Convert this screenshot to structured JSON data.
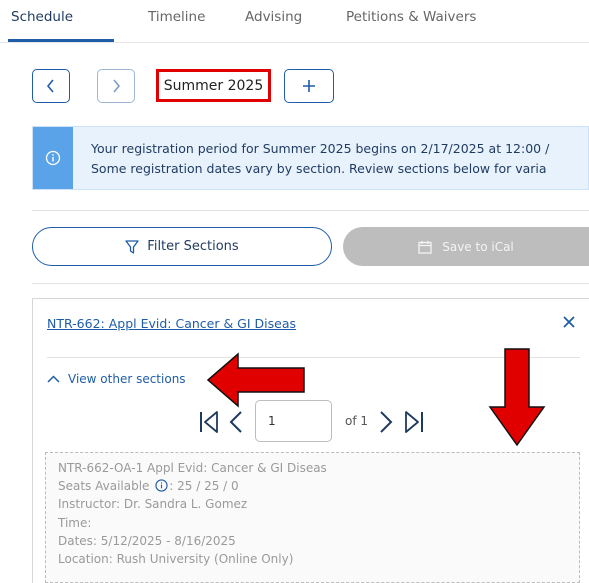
{
  "tabs": [
    {
      "label": "Schedule",
      "active": true
    },
    {
      "label": "Timeline",
      "active": false
    },
    {
      "label": "Advising",
      "active": false
    },
    {
      "label": "Petitions & Waivers",
      "active": false
    }
  ],
  "term": {
    "label": "Summer 2025"
  },
  "banner": {
    "line1": "Your registration period for Summer 2025 begins on 2/17/2025 at 12:00 /",
    "line2": "Some registration dates vary by section. Review sections below for varia"
  },
  "actions": {
    "filter_label": "Filter Sections",
    "ical_label": "Save to iCal"
  },
  "course": {
    "title": "NTR-662: Appl Evid: Cancer & GI Diseas",
    "view_other_label": "View other sections",
    "pager": {
      "current_page": "1",
      "of_label": "of 1"
    },
    "section": {
      "name": "NTR-662-OA-1 Appl Evid: Cancer & GI Diseas",
      "seats_label": "Seats Available",
      "seats_value": ": 25 / 25 / 0",
      "instructor": "Instructor: Dr. Sandra L. Gomez",
      "time": "Time:",
      "dates": "Dates: 5/12/2025 - 8/16/2025",
      "location": "Location: Rush University (Online Only)"
    }
  },
  "colors": {
    "accent": "#1f5da8",
    "highlight_red": "#e10000",
    "banner_bg": "#e8f2fd",
    "banner_icon_bg": "#5ba3e8"
  },
  "icons": [
    "chevron-left-icon",
    "chevron-right-icon",
    "plus-icon",
    "info-icon",
    "filter-icon",
    "calendar-icon",
    "close-icon",
    "chevron-up-icon",
    "first-page-icon",
    "prev-page-icon",
    "next-page-icon",
    "last-page-icon",
    "red-arrow-left-icon",
    "red-arrow-down-icon"
  ]
}
